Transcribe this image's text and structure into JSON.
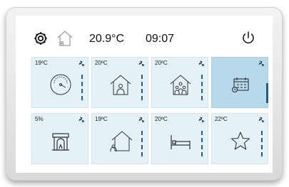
{
  "status_bar": {
    "icons": [
      "gear-icon",
      "house-outline-icon",
      "power-icon"
    ],
    "temperature": "20.9°C",
    "time": "09:07"
  },
  "tiles": [
    {
      "value": "19ºC",
      "icon": "speedometer-icon",
      "active": false
    },
    {
      "value": "20ºC",
      "icon": "house-person-icon",
      "active": false
    },
    {
      "value": "20ºC",
      "icon": "house-family-icon",
      "active": false
    },
    {
      "value": "",
      "icon": "calendar-clock-icon",
      "active": true
    },
    {
      "value": "5%",
      "icon": "fireplace-icon",
      "active": false
    },
    {
      "value": "19ºC",
      "icon": "house-away-icon",
      "active": false
    },
    {
      "value": "20ºC",
      "icon": "bed-icon",
      "active": false
    },
    {
      "value": "22ºC",
      "icon": "star-icon",
      "active": false
    }
  ],
  "colors": {
    "tile_bg": "#e4f1f7",
    "tile_active_bg": "#b8d9ec",
    "accent": "#1a5f9a",
    "icon_stroke": "#333333"
  }
}
